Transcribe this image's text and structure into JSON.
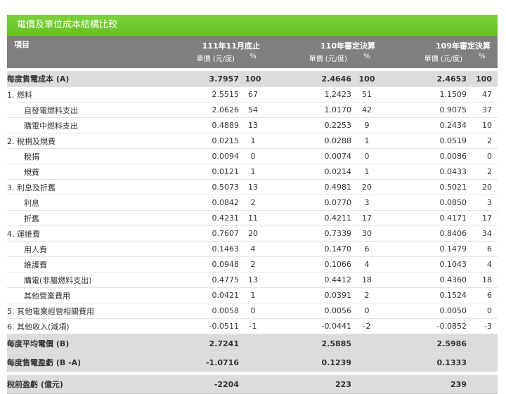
{
  "title": "電價及單位成本結構比較",
  "header": {
    "item": "項目",
    "years": [
      "111年11月底止",
      "110年審定決算",
      "109年審定決算"
    ],
    "price_unit": "單價 (元/度)",
    "pct": "%"
  },
  "rows": [
    {
      "name": "每度售電成本 (A)",
      "level": "sum",
      "v": [
        "3.7957",
        "100",
        "2.4646",
        "100",
        "2.4653",
        "100"
      ]
    },
    {
      "name": "1. 燃料",
      "level": 1,
      "v": [
        "2.5515",
        "67",
        "1.2423",
        "51",
        "1.1509",
        "47"
      ]
    },
    {
      "name": "自發電燃料支出",
      "level": 2,
      "v": [
        "2.0626",
        "54",
        "1.0170",
        "42",
        "0.9075",
        "37"
      ]
    },
    {
      "name": "購電中燃料支出",
      "level": 2,
      "v": [
        "0.4889",
        "13",
        "0.2253",
        "9",
        "0.2434",
        "10"
      ]
    },
    {
      "name": "2. 稅捐及規費",
      "level": 1,
      "v": [
        "0.0215",
        "1",
        "0.0288",
        "1",
        "0.0519",
        "2"
      ]
    },
    {
      "name": "稅捐",
      "level": 2,
      "v": [
        "0.0094",
        "0",
        "0.0074",
        "0",
        "0.0086",
        "0"
      ]
    },
    {
      "name": "規費",
      "level": 2,
      "v": [
        "0.0121",
        "1",
        "0.0214",
        "1",
        "0.0433",
        "2"
      ]
    },
    {
      "name": "3. 利息及折舊",
      "level": 1,
      "v": [
        "0.5073",
        "13",
        "0.4981",
        "20",
        "0.5021",
        "20"
      ]
    },
    {
      "name": "利息",
      "level": 2,
      "v": [
        "0.0842",
        "2",
        "0.0770",
        "3",
        "0.0850",
        "3"
      ]
    },
    {
      "name": "折舊",
      "level": 2,
      "v": [
        "0.4231",
        "11",
        "0.4211",
        "17",
        "0.4171",
        "17"
      ]
    },
    {
      "name": "4. 運維費",
      "level": 1,
      "v": [
        "0.7607",
        "20",
        "0.7339",
        "30",
        "0.8406",
        "34"
      ]
    },
    {
      "name": "用人費",
      "level": 2,
      "v": [
        "0.1463",
        "4",
        "0.1470",
        "6",
        "0.1479",
        "6"
      ]
    },
    {
      "name": "維護費",
      "level": 2,
      "v": [
        "0.0948",
        "2",
        "0.1066",
        "4",
        "0.1043",
        "4"
      ]
    },
    {
      "name": "購電(非屬燃料支出)",
      "level": 2,
      "v": [
        "0.4775",
        "13",
        "0.4412",
        "18",
        "0.4360",
        "18"
      ]
    },
    {
      "name": "其他營業費用",
      "level": 2,
      "v": [
        "0.0421",
        "1",
        "0.0391",
        "2",
        "0.1524",
        "6"
      ]
    },
    {
      "name": "5. 其他電業經營相關費用",
      "level": 1,
      "v": [
        "0.0058",
        "0",
        "0.0056",
        "0",
        "0.0050",
        "0"
      ]
    },
    {
      "name": "6. 其他收入(減項)",
      "level": 1,
      "v": [
        "-0.0511",
        "-1",
        "-0.0441",
        "-2",
        "-0.0852",
        "-3"
      ]
    },
    {
      "name": "每度平均電價 (B)",
      "level": "sum",
      "v": [
        "2.7241",
        "",
        "2.5885",
        "",
        "2.5986",
        ""
      ]
    },
    {
      "name": "每度售電盈虧 (B -A)",
      "level": "sum",
      "v": [
        "-1.0716",
        "",
        "0.1239",
        "",
        "0.1333",
        ""
      ]
    },
    {
      "name": "稅前盈虧 (億元)",
      "level": "sum",
      "v": [
        "-2204",
        "",
        "223",
        "",
        "239",
        ""
      ]
    }
  ]
}
